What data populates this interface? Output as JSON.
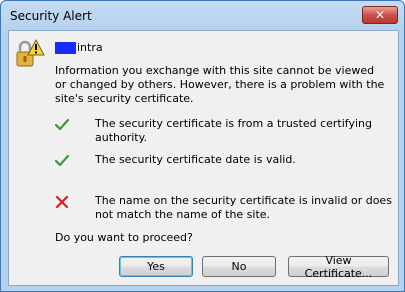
{
  "window": {
    "title": "Security Alert",
    "close_glyph": "✕"
  },
  "icons": {
    "alert": "security-lock-warning-icon",
    "check": "checkmark-icon",
    "error": "red-x-icon"
  },
  "colors": {
    "check": "#3c9a3c",
    "error": "#d41f1f",
    "redaction": "#1a2bff"
  },
  "hostname": {
    "suffix": "intra"
  },
  "message": "Information you exchange with this site cannot be viewed or changed by others. However, there is a problem with the site's security certificate.",
  "checks": [
    {
      "status": "ok",
      "text": "The security certificate is from a trusted certifying authority."
    },
    {
      "status": "ok",
      "text": "The security certificate date is valid."
    },
    {
      "status": "error",
      "text": "The name on the security certificate is invalid or does not match the name of the site."
    }
  ],
  "question": "Do you want to proceed?",
  "buttons": {
    "yes": "Yes",
    "no": "No",
    "view": "View Certificate..."
  }
}
